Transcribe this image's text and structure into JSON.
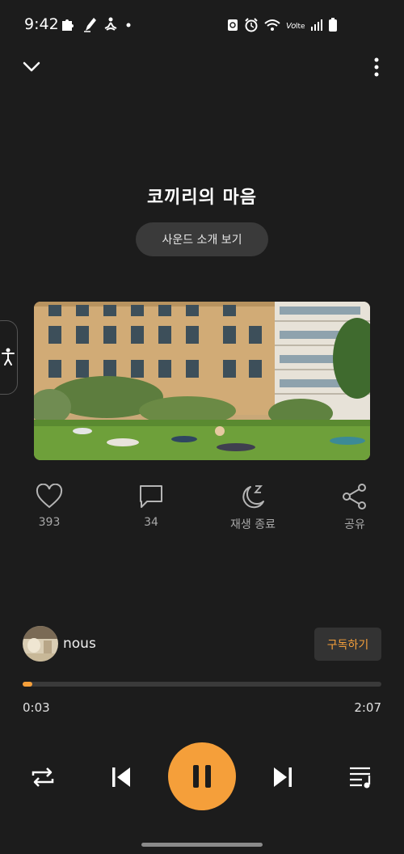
{
  "status_bar": {
    "time": "9:42",
    "icons_left": [
      "puzzle-icon",
      "pen-icon",
      "meditation-icon",
      "dot"
    ],
    "icons_right": [
      "sync-icon",
      "alarm-icon",
      "wifi-icon",
      "volte-signal-icon",
      "signal-icon",
      "battery-icon"
    ]
  },
  "track": {
    "title": "코끼리의 마음",
    "intro_button": "사운드 소개 보기"
  },
  "actions": [
    {
      "icon": "heart-icon",
      "label": "393"
    },
    {
      "icon": "comment-icon",
      "label": "34"
    },
    {
      "icon": "sleep-timer-icon",
      "label": "재생 종료"
    },
    {
      "icon": "share-icon",
      "label": "공유"
    }
  ],
  "artist": {
    "name": "nous",
    "subscribe_label": "구독하기"
  },
  "player": {
    "current_time": "0:03",
    "total_time": "2:07",
    "progress": 0.024,
    "accent_color": "#f59f3a",
    "state": "playing"
  }
}
